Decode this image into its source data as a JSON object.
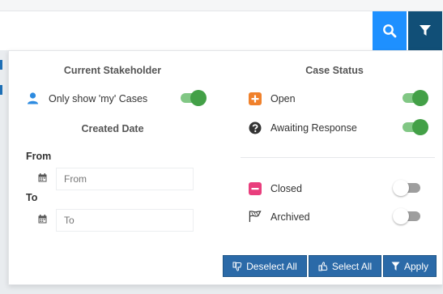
{
  "toolbar": {
    "search_icon": "search-icon",
    "filter_icon": "filter-icon",
    "search_color": "#1e90ff",
    "filter_color": "#114f77"
  },
  "stakeholder": {
    "heading": "Current Stakeholder",
    "my_cases_label": "Only show 'my' Cases",
    "my_cases_on": true
  },
  "created_date": {
    "heading": "Created Date",
    "from_label": "From",
    "from_placeholder": "From",
    "to_label": "To",
    "to_placeholder": "To"
  },
  "case_status": {
    "heading": "Case Status",
    "items": [
      {
        "label": "Open",
        "icon": "plus-square-icon",
        "color": "#f0812c",
        "on": true
      },
      {
        "label": "Awaiting Response",
        "icon": "question-circle-icon",
        "color": "#333333",
        "on": true
      },
      {
        "label": "Closed",
        "icon": "minus-square-icon",
        "color": "#e93e7d",
        "on": false
      },
      {
        "label": "Archived",
        "icon": "flag-icon",
        "color": "#333333",
        "on": false
      }
    ]
  },
  "actions": {
    "deselect_label": "Deselect All",
    "select_label": "Select All",
    "apply_label": "Apply",
    "button_color": "#2b6aa8"
  }
}
